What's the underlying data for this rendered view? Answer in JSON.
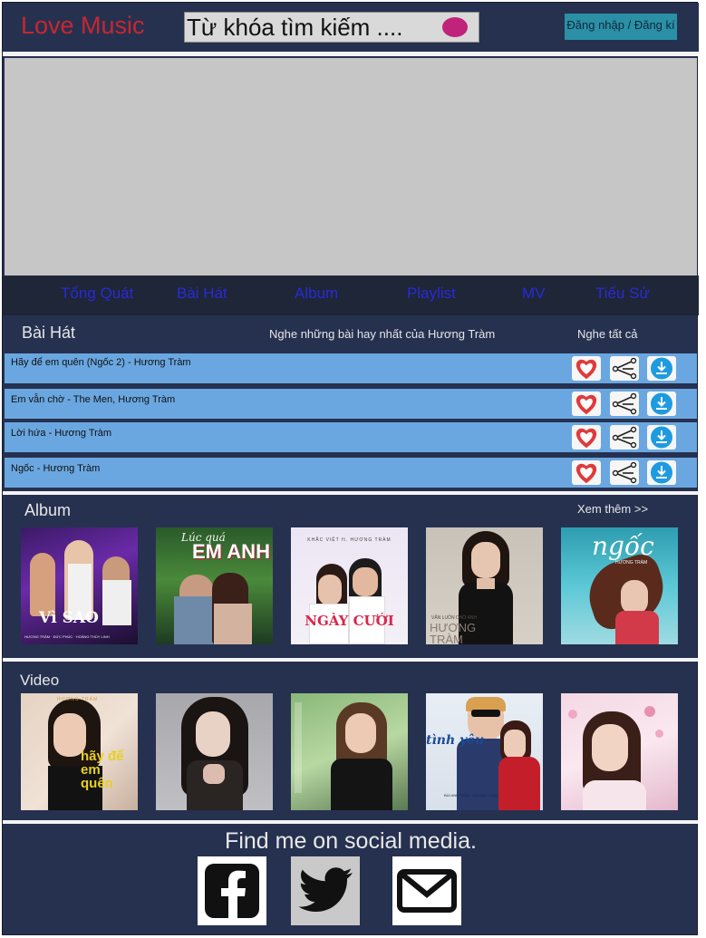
{
  "header": {
    "logo": "Love Music",
    "search_placeholder": "Từ khóa tìm kiếm ....",
    "login_label": "Đăng nhập / Đăng kí"
  },
  "nav": {
    "items": [
      "Tổng Quát",
      "Bài Hát",
      "Album",
      "Playlist",
      "MV",
      "Tiểu Sử"
    ]
  },
  "songs": {
    "title": "Bài Hát",
    "subtitle": "Nghe những bài hay nhất của Hương Tràm",
    "listen_all": "Nghe tất cả",
    "items": [
      "Hãy để em quên (Ngốc 2) - Hương Tràm",
      "Em vẫn chờ - The Men, Hương Tràm",
      "Lời hứa - Hương Tràm",
      "Ngốc - Hương Tràm"
    ]
  },
  "album": {
    "title": "Album",
    "more": "Xem thêm >>",
    "covers": [
      {
        "name": "album-cover-vi-sao",
        "text_big": "Vì SAO",
        "text_small": "HƯƠNG TRÀM · ĐỨC PHÚC · HOÀNG THÙY LINH"
      },
      {
        "name": "album-cover-em-anh",
        "text_big": "EM ANH",
        "text_small": "Lúc quá"
      },
      {
        "name": "album-cover-ngay-cuoi",
        "text_big": "NGÀY CƯỚI",
        "text_small": "KHẮC VIỆT ft. HƯƠNG TRÀM"
      },
      {
        "name": "album-cover-em-van-cho",
        "text_big": "HƯƠNG TRÀM",
        "text_small": "VẪN LUÔN CHỜ ANH"
      },
      {
        "name": "album-cover-ngoc",
        "text_big": "ngốc",
        "text_small": "HƯƠNG TRÀM"
      }
    ]
  },
  "video": {
    "title": "Video",
    "thumbs": [
      {
        "name": "video-thumb-hay-de-em-quen",
        "text_big": "hãy để em quên",
        "text_small": "HƯƠNG TRÀM"
      },
      {
        "name": "video-thumb-2",
        "text_big": "",
        "text_small": ""
      },
      {
        "name": "video-thumb-3",
        "text_big": "",
        "text_small": ""
      },
      {
        "name": "video-thumb-em-van-cho",
        "text_big": "tình yêu",
        "text_small": "BÙI ANH TUẤN · HƯƠNG TRÀM"
      },
      {
        "name": "video-thumb-5",
        "text_big": "",
        "text_small": ""
      }
    ]
  },
  "footer": {
    "text": "Find me on social media.",
    "icons": [
      "facebook-icon",
      "twitter-icon",
      "mail-icon"
    ]
  },
  "colors": {
    "page_bg": "#263150",
    "logo": "#c8272f",
    "nav_text": "#2a2ad6",
    "song_row": "#6aa7e0",
    "login_bg": "#2a90a6",
    "search_button": "#c0247a",
    "banner": "#c6c6c6"
  }
}
